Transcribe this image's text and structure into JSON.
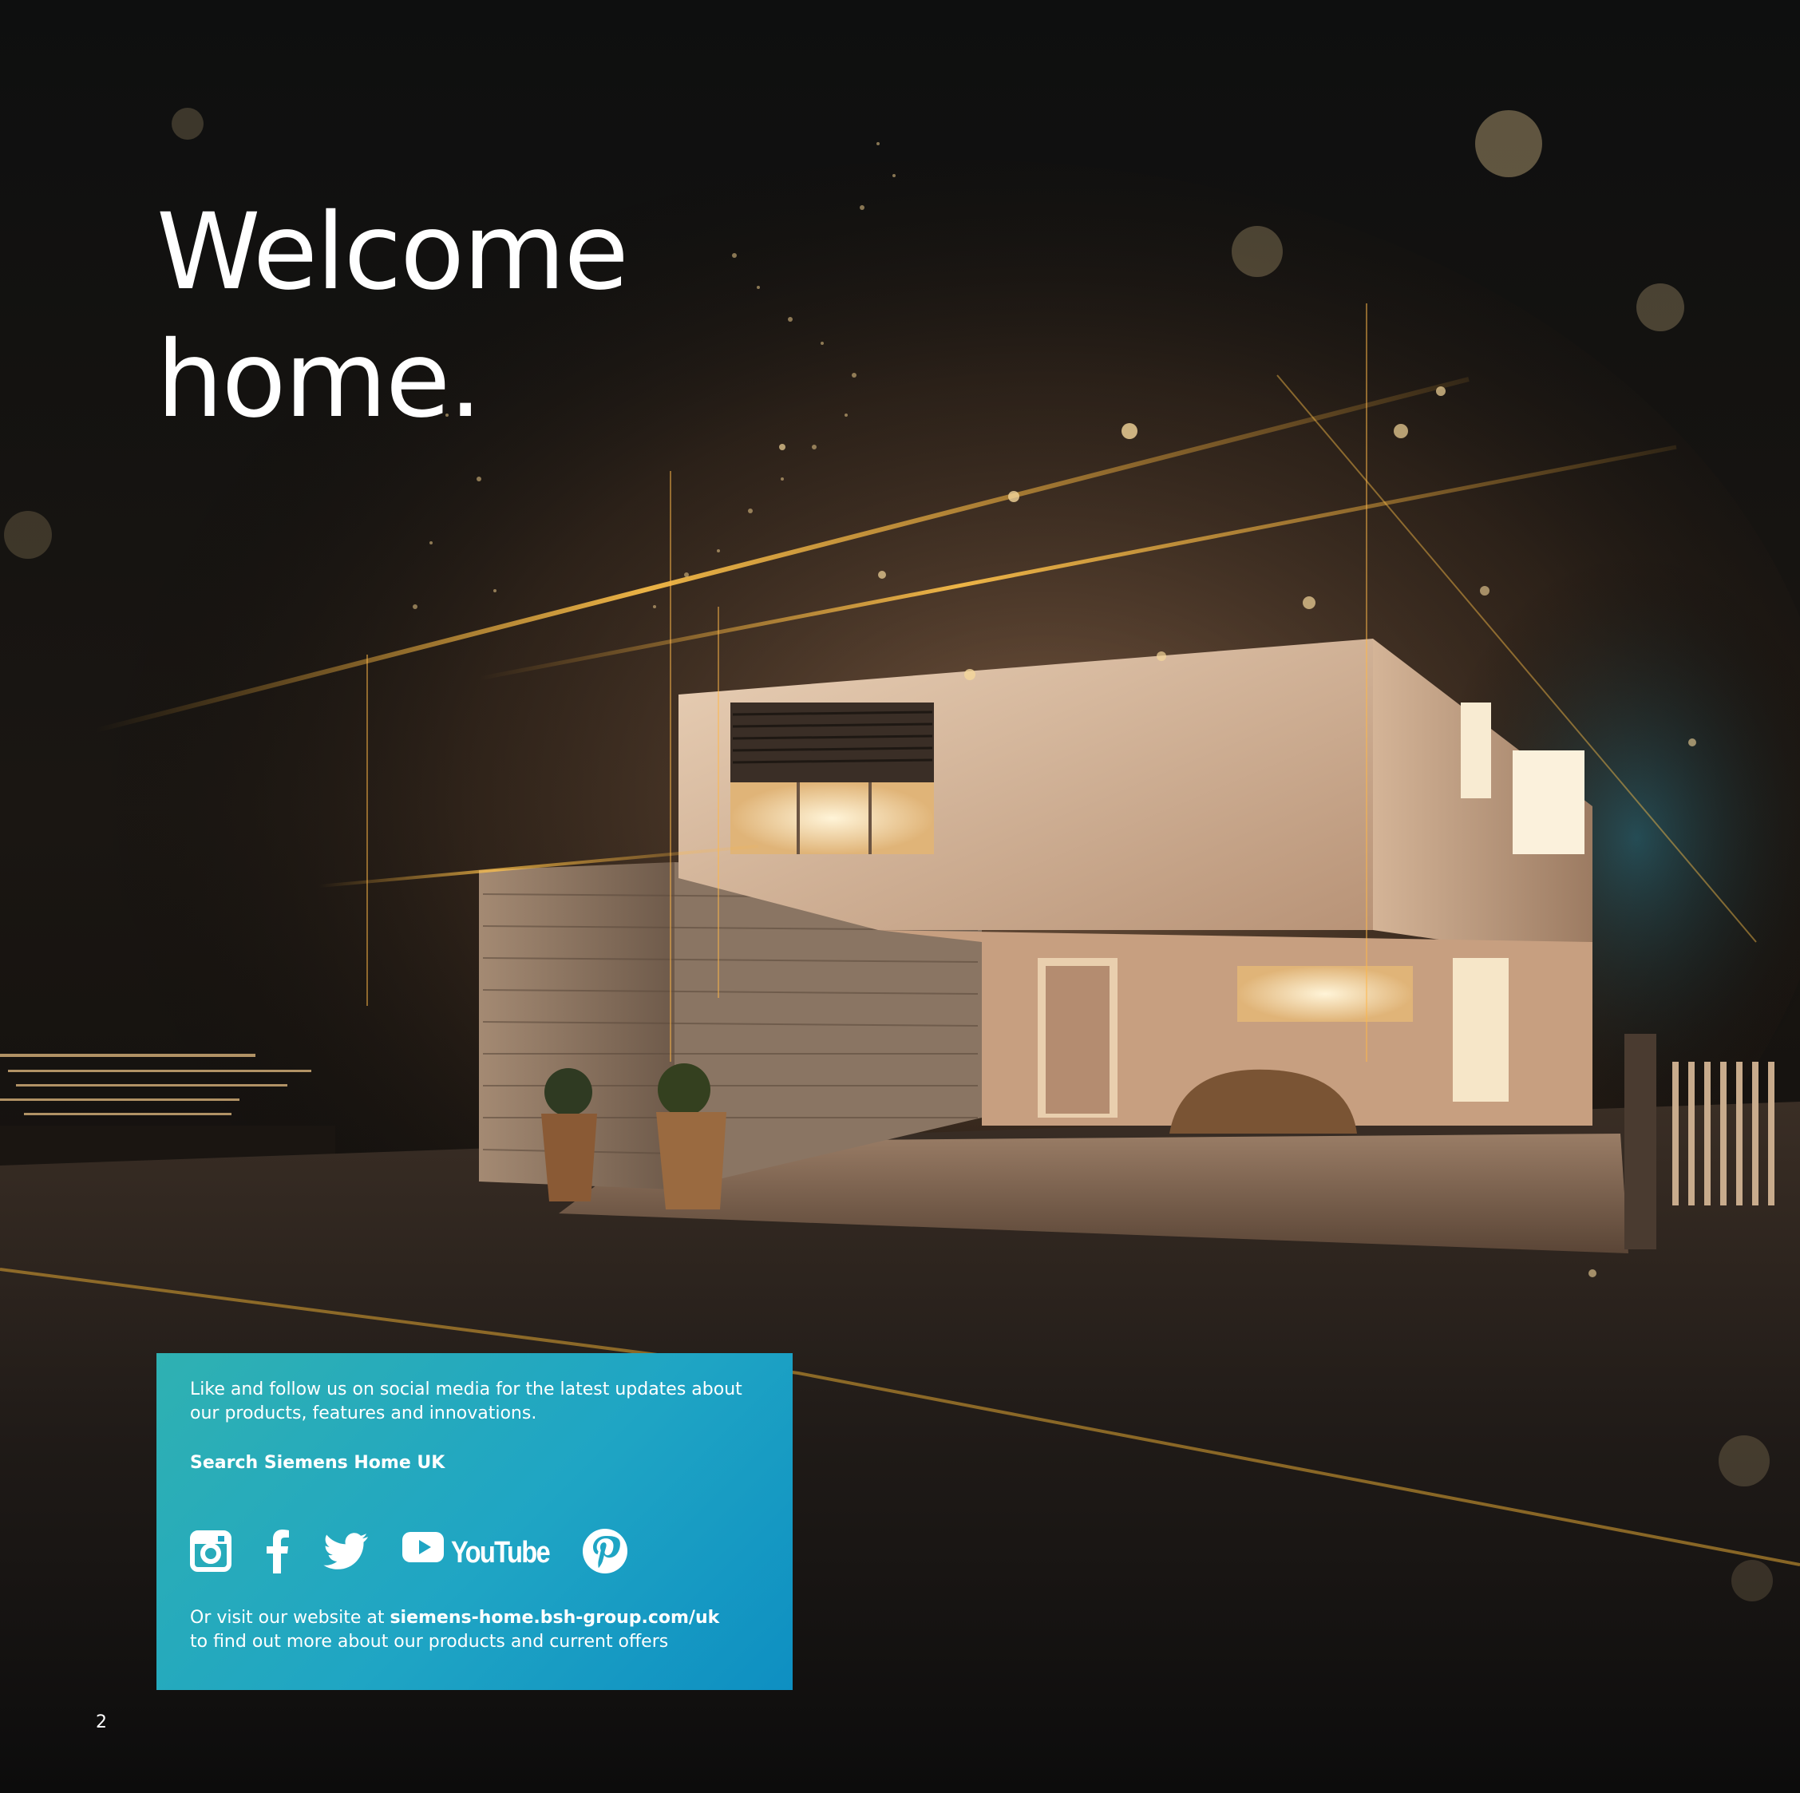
{
  "headline": {
    "line1": "Welcome",
    "line2": "home."
  },
  "info_box": {
    "intro": "Like and follow us on social media for the latest updates about our products, features and innovations.",
    "search": "Search Siemens Home UK",
    "socials": {
      "instagram_icon": "instagram-icon",
      "facebook_icon": "facebook-icon",
      "twitter_icon": "twitter-icon",
      "youtube_label": "YouTube",
      "pinterest_icon": "pinterest-icon"
    },
    "visit_prefix": "Or visit our website at ",
    "website": "siemens-home.bsh-group.com/uk",
    "visit_suffix": "to find out more about our products and current offers",
    "background_colors": [
      "#2fb1b2",
      "#0e8fc2"
    ]
  },
  "page_number": "2"
}
